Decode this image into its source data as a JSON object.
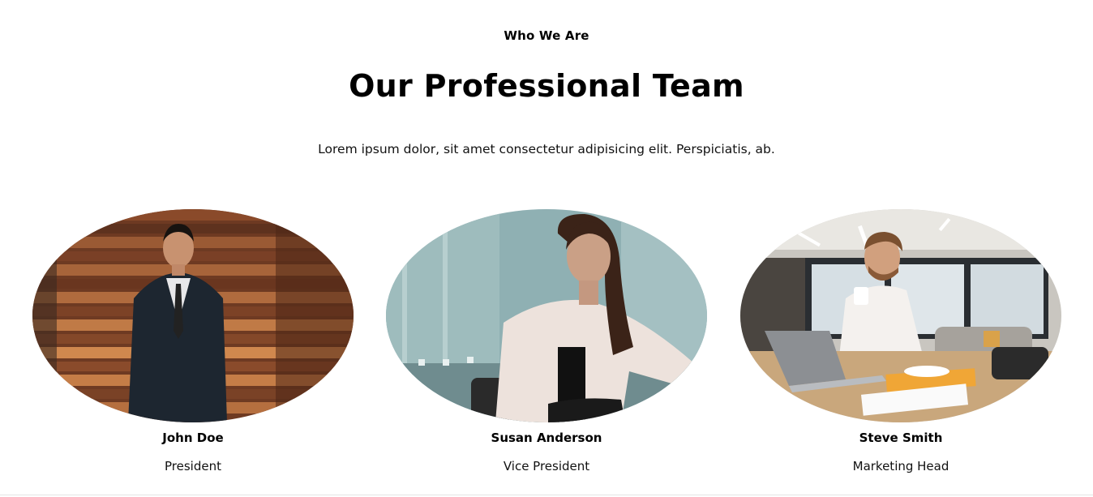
{
  "section": {
    "eyebrow": "Who We Are",
    "title": "Our Professional Team",
    "subtitle": "Lorem ipsum dolor, sit amet consectetur adipisicing elit. Perspiciatis, ab."
  },
  "team": [
    {
      "name": "John Doe",
      "role": "President"
    },
    {
      "name": "Susan Anderson",
      "role": "Vice President"
    },
    {
      "name": "Steve Smith",
      "role": "Marketing Head"
    }
  ]
}
